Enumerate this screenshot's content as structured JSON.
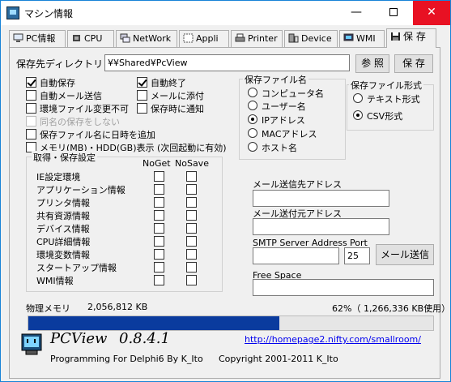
{
  "window": {
    "title": "マシン情報",
    "minimize": "—",
    "close": "✕"
  },
  "tabs": [
    {
      "label": "PC情報",
      "icon": "pc-icon"
    },
    {
      "label": "CPU",
      "icon": "cpu-icon"
    },
    {
      "label": "NetWork",
      "icon": "network-icon"
    },
    {
      "label": "Appli",
      "icon": "appli-icon"
    },
    {
      "label": "Printer",
      "icon": "printer-icon"
    },
    {
      "label": "Device",
      "icon": "device-icon"
    },
    {
      "label": "WMI",
      "icon": "wmi-icon"
    },
    {
      "label": "保 存",
      "icon": "floppy-disk-icon"
    }
  ],
  "save": {
    "folder_label": "保存先ディレクトリ",
    "folder_value": "¥¥Shared¥PcView",
    "browse_button": "参 照",
    "save_button": "保 存"
  },
  "options": [
    {
      "label": "自動保存",
      "checked": true,
      "disabled": false
    },
    {
      "label": "自動終了",
      "checked": true,
      "disabled": false
    },
    {
      "label": "自動メール送信",
      "checked": false,
      "disabled": false
    },
    {
      "label": "メールに添付",
      "checked": false,
      "disabled": false
    },
    {
      "label": "環境ファイル変更不可",
      "checked": false,
      "disabled": false
    },
    {
      "label": "保存時に通知",
      "checked": false,
      "disabled": false
    },
    {
      "label": "同名の保存をしない",
      "checked": false,
      "disabled": true
    },
    {
      "label": "保存ファイル名に日時を追加",
      "checked": false,
      "disabled": false
    },
    {
      "label": "メモリ(MB)・HDD(GB)表示 (次回起動に有効)",
      "checked": false,
      "disabled": false
    }
  ],
  "filename_group": {
    "title": "保存ファイル名",
    "options": [
      "コンピュータ名",
      "ユーザー名",
      "IPアドレス",
      "MACアドレス",
      "ホスト名"
    ],
    "selected": "IPアドレス"
  },
  "format_group": {
    "title": "保存ファイル形式",
    "options": [
      "テキスト形式",
      "CSV形式"
    ],
    "selected": "CSV形式"
  },
  "acquire_group": {
    "title": "取得・保存設定",
    "col_noget": "NoGet",
    "col_nosave": "NoSave",
    "items": [
      "IE設定環境",
      "アプリケーション情報",
      "プリンタ情報",
      "共有資源情報",
      "デバイス情報",
      "CPU詳細情報",
      "環境変数情報",
      "スタートアップ情報",
      "WMI情報"
    ]
  },
  "mail": {
    "to_label": "メール送信先アドレス",
    "to_value": "",
    "from_label": "メール送付元アドレス",
    "from_value": "",
    "smtp_label": "SMTP Server Address",
    "port_label": "Port",
    "smtp_value": "",
    "port_value": "25",
    "send_button": "メール送信",
    "free_label": "Free Space",
    "free_value": ""
  },
  "memory": {
    "label": "物理メモリ",
    "total": "2,056,812 KB",
    "usage_text": "62%（ 1,266,336 KB使用）",
    "usage_fraction": 0.62,
    "bar_color": "#0a3b9e"
  },
  "footer": {
    "app_name": "PCView",
    "version": "0.8.4.1",
    "url": "http://homepage2.nifty.com/smallroom/",
    "credit": "Programming For Delphi6 By K_Ito",
    "copyright": "Copyright 2001-2011 K_Ito"
  }
}
